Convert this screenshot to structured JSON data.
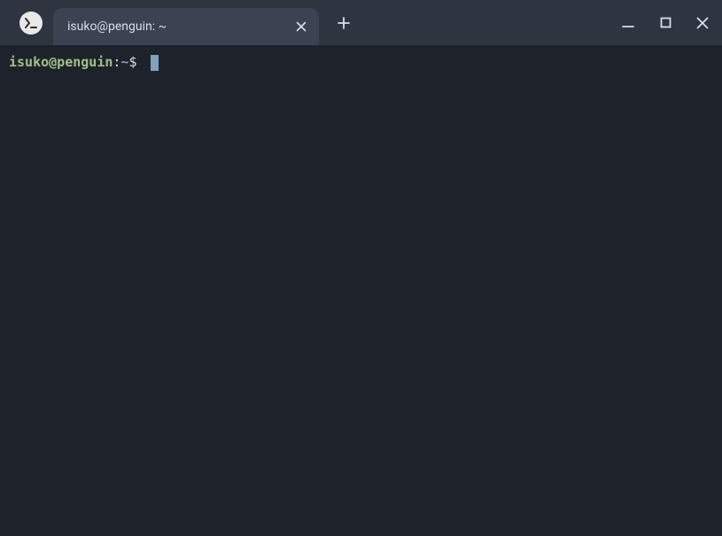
{
  "titlebar": {
    "tab_title": "isuko@penguin: ~"
  },
  "prompt": {
    "user_host": "isuko@penguin",
    "separator": ":",
    "path": "~",
    "symbol": "$ "
  }
}
